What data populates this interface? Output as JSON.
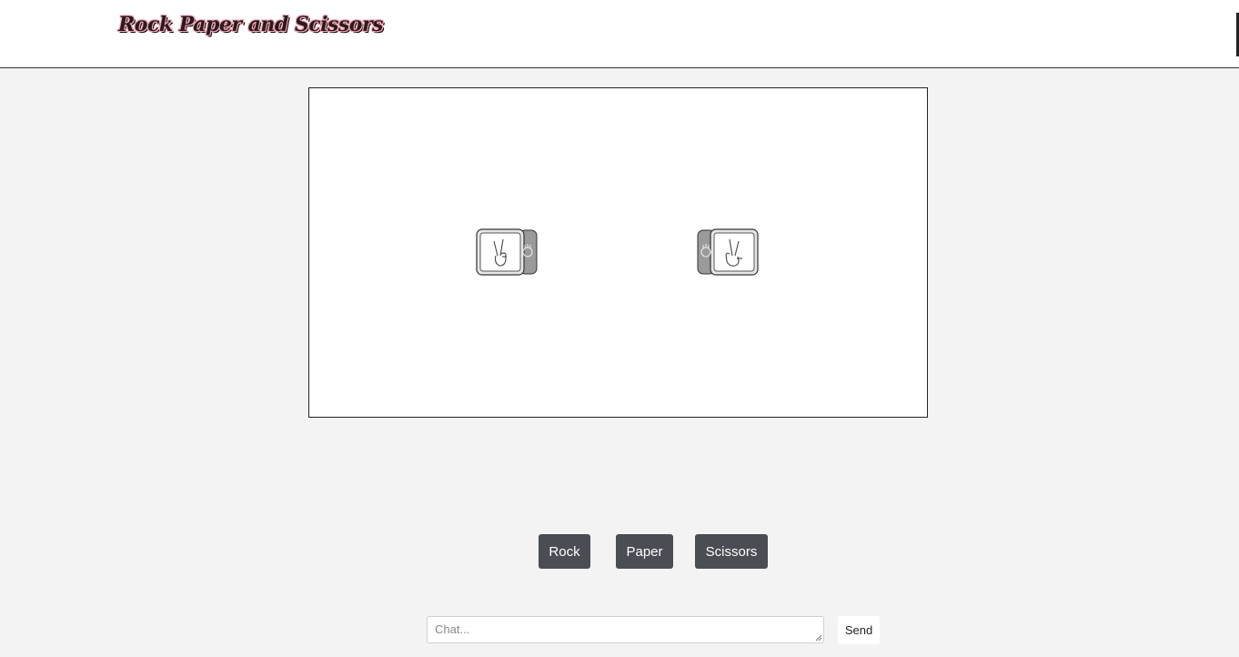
{
  "header": {
    "logo_text": "Rock Paper and Scissors"
  },
  "board": {
    "player_die_icon": "scissors-hand-icon",
    "opponent_die_icon": "scissors-hand-icon"
  },
  "controls": {
    "rock_label": "Rock",
    "paper_label": "Paper",
    "scissors_label": "Scissors"
  },
  "chat": {
    "placeholder": "Chat...",
    "value": "",
    "send_label": "Send"
  },
  "colors": {
    "page_background": "#f3f3f3",
    "button_background": "#4a4d53",
    "logo_accent": "#f3a9b6"
  }
}
